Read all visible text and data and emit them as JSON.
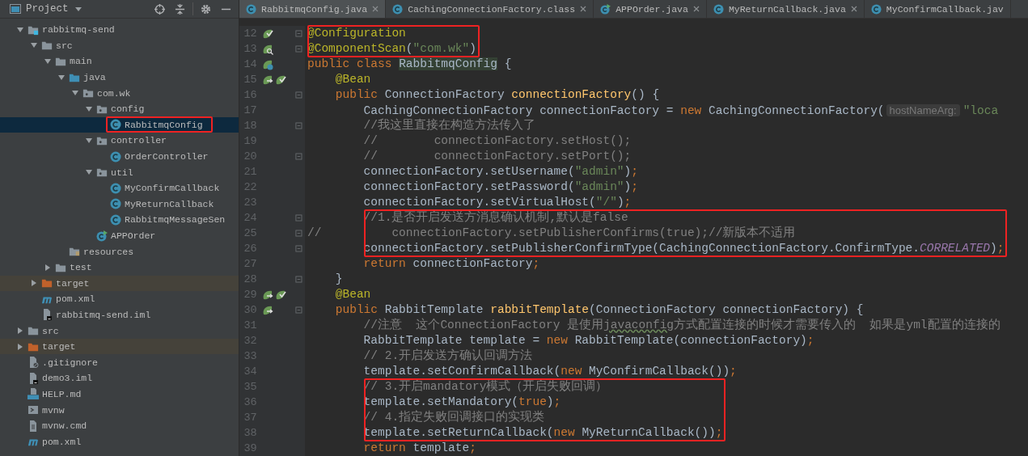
{
  "project_panel": {
    "title": "Project",
    "tree": [
      {
        "label": "rabbitmq-send",
        "kind": "module",
        "expanded": true,
        "selected": false,
        "boxed": false,
        "children": [
          {
            "label": "src",
            "kind": "folder",
            "expanded": true,
            "selected": false,
            "boxed": false,
            "children": [
              {
                "label": "main",
                "kind": "folder",
                "expanded": true,
                "selected": false,
                "boxed": false,
                "children": [
                  {
                    "label": "java",
                    "kind": "source-folder",
                    "expanded": true,
                    "selected": false,
                    "boxed": false,
                    "children": [
                      {
                        "label": "com.wk",
                        "kind": "package",
                        "expanded": true,
                        "selected": false,
                        "boxed": false,
                        "children": [
                          {
                            "label": "config",
                            "kind": "package",
                            "expanded": true,
                            "selected": false,
                            "boxed": false,
                            "children": [
                              {
                                "label": "RabbitmqConfig",
                                "kind": "class",
                                "selected": true,
                                "boxed": true
                              }
                            ]
                          },
                          {
                            "label": "controller",
                            "kind": "package",
                            "expanded": true,
                            "selected": false,
                            "boxed": false,
                            "children": [
                              {
                                "label": "OrderController",
                                "kind": "class",
                                "selected": false,
                                "boxed": false
                              }
                            ]
                          },
                          {
                            "label": "util",
                            "kind": "package",
                            "expanded": true,
                            "selected": false,
                            "boxed": false,
                            "children": [
                              {
                                "label": "MyConfirmCallback",
                                "kind": "class",
                                "selected": false,
                                "boxed": false
                              },
                              {
                                "label": "MyReturnCallback",
                                "kind": "class",
                                "selected": false,
                                "boxed": false
                              },
                              {
                                "label": "RabbitmqMessageSen",
                                "kind": "class",
                                "selected": false,
                                "boxed": false
                              }
                            ]
                          },
                          {
                            "label": "APPOrder",
                            "kind": "app-class",
                            "selected": false,
                            "boxed": false
                          }
                        ]
                      }
                    ]
                  },
                  {
                    "label": "resources",
                    "kind": "resources",
                    "selected": false,
                    "boxed": false
                  }
                ]
              },
              {
                "label": "test",
                "kind": "folder",
                "expanded": false,
                "selected": false,
                "boxed": false
              }
            ]
          },
          {
            "label": "target",
            "kind": "excluded-folder",
            "expanded": false,
            "selected": false,
            "boxed": false
          },
          {
            "label": "pom.xml",
            "kind": "maven",
            "selected": false,
            "boxed": false
          },
          {
            "label": "rabbitmq-send.iml",
            "kind": "iml",
            "selected": false,
            "boxed": false
          }
        ]
      },
      {
        "label": "src",
        "kind": "folder",
        "expanded": false,
        "selected": false,
        "boxed": false
      },
      {
        "label": "target",
        "kind": "excluded-folder",
        "expanded": false,
        "selected": false,
        "boxed": false
      },
      {
        "label": ".gitignore",
        "kind": "gitignore",
        "selected": false,
        "boxed": false
      },
      {
        "label": "demo3.iml",
        "kind": "iml",
        "selected": false,
        "boxed": false
      },
      {
        "label": "HELP.md",
        "kind": "markdown",
        "selected": false,
        "boxed": false
      },
      {
        "label": "mvnw",
        "kind": "script",
        "selected": false,
        "boxed": false
      },
      {
        "label": "mvnw.cmd",
        "kind": "text",
        "selected": false,
        "boxed": false
      },
      {
        "label": "pom.xml",
        "kind": "maven",
        "selected": false,
        "boxed": false
      }
    ]
  },
  "tabs": [
    {
      "label": "RabbitmqConfig.java",
      "kind": "class",
      "selected": true,
      "closable": true
    },
    {
      "label": "CachingConnectionFactory.class",
      "kind": "class",
      "selected": false,
      "closable": true
    },
    {
      "label": "APPOrder.java",
      "kind": "app-class",
      "selected": false,
      "closable": true
    },
    {
      "label": "MyReturnCallback.java",
      "kind": "class",
      "selected": false,
      "closable": true
    },
    {
      "label": "MyConfirmCallback.jav",
      "kind": "class",
      "selected": false,
      "closable": false
    }
  ],
  "lines": [
    {
      "number": "12",
      "gutter_icons": [
        {
          "kind": "bean-check"
        }
      ],
      "fold": true,
      "boxed": true,
      "segments": [
        {
          "kind": "annotation",
          "text": "@Configuration"
        }
      ]
    },
    {
      "number": "13",
      "gutter_icons": [
        {
          "kind": "bean-search"
        }
      ],
      "fold": true,
      "boxed": true,
      "segments": [
        {
          "kind": "annotation",
          "text": "@ComponentScan"
        },
        {
          "kind": "plain",
          "text": "("
        },
        {
          "kind": "string",
          "text": "\"com.wk\""
        },
        {
          "kind": "plain",
          "text": ")"
        }
      ]
    },
    {
      "number": "14",
      "gutter_icons": [
        {
          "kind": "bean-class"
        }
      ],
      "fold": false,
      "boxed": false,
      "segments": [
        {
          "kind": "keyword",
          "text": "public class "
        },
        {
          "kind": "highlight",
          "text": "RabbitmqConfig"
        },
        {
          "kind": "plain",
          "text": " {"
        }
      ]
    },
    {
      "number": "15",
      "gutter_icons": [
        {
          "kind": "bean-arrow"
        },
        {
          "kind": "bean-check"
        }
      ],
      "fold": false,
      "boxed": false,
      "segments": [
        {
          "kind": "annotation",
          "text": "    @Bean"
        }
      ]
    },
    {
      "number": "16",
      "fold": true,
      "boxed": false,
      "segments": [
        {
          "kind": "keyword",
          "text": "    public "
        },
        {
          "kind": "plain",
          "text": "ConnectionFactory "
        },
        {
          "kind": "method",
          "text": "connectionFactory"
        },
        {
          "kind": "plain",
          "text": "() {"
        }
      ]
    },
    {
      "number": "17",
      "fold": false,
      "boxed": false,
      "segments": [
        {
          "kind": "plain",
          "text": "        CachingConnectionFactory connectionFactory = "
        },
        {
          "kind": "keyword",
          "text": "new "
        },
        {
          "kind": "plain",
          "text": "CachingConnectionFactory("
        },
        {
          "kind": "hint",
          "text": "hostNameArg:"
        },
        {
          "kind": "string",
          "text": "\"loca"
        }
      ]
    },
    {
      "number": "18",
      "fold": true,
      "boxed": false,
      "segments": [
        {
          "kind": "comment",
          "text": "        //我这里直接在构造方法传入了"
        }
      ]
    },
    {
      "number": "19",
      "fold": false,
      "boxed": false,
      "segments": [
        {
          "kind": "comment",
          "text": "        //        connectionFactory.setHost();"
        }
      ]
    },
    {
      "number": "20",
      "fold": true,
      "boxed": false,
      "segments": [
        {
          "kind": "comment",
          "text": "        //        connectionFactory.setPort();"
        }
      ]
    },
    {
      "number": "21",
      "fold": false,
      "boxed": false,
      "segments": [
        {
          "kind": "plain",
          "text": "        connectionFactory.setUsername("
        },
        {
          "kind": "string",
          "text": "\"admin\""
        },
        {
          "kind": "plain",
          "text": ")"
        },
        {
          "kind": "keyword",
          "text": ";"
        }
      ]
    },
    {
      "number": "22",
      "fold": false,
      "boxed": false,
      "segments": [
        {
          "kind": "plain",
          "text": "        connectionFactory.setPassword("
        },
        {
          "kind": "string",
          "text": "\"admin\""
        },
        {
          "kind": "plain",
          "text": ")"
        },
        {
          "kind": "keyword",
          "text": ";"
        }
      ]
    },
    {
      "number": "23",
      "fold": false,
      "boxed": false,
      "segments": [
        {
          "kind": "plain",
          "text": "        connectionFactory.setVirtualHost("
        },
        {
          "kind": "string",
          "text": "\"/\""
        },
        {
          "kind": "plain",
          "text": ")"
        },
        {
          "kind": "keyword",
          "text": ";"
        }
      ]
    },
    {
      "number": "24",
      "fold": true,
      "boxed": true,
      "segments": [
        {
          "kind": "comment",
          "text": "        //1.是否开启发送方消息确认机制,默认是false"
        }
      ]
    },
    {
      "number": "25",
      "fold": true,
      "boxed": true,
      "segments": [
        {
          "kind": "comment",
          "text": "//          connectionFactory.setPublisherConfirms(true);//新版本不适用"
        }
      ]
    },
    {
      "number": "26",
      "fold": true,
      "boxed": true,
      "segments": [
        {
          "kind": "plain",
          "text": "        connectionFactory.setPublisherConfirmType(CachingConnectionFactory.ConfirmType."
        },
        {
          "kind": "constant",
          "text": "CORRELATED"
        },
        {
          "kind": "plain",
          "text": ")"
        },
        {
          "kind": "keyword",
          "text": ";"
        }
      ]
    },
    {
      "number": "27",
      "fold": false,
      "boxed": false,
      "segments": [
        {
          "kind": "keyword",
          "text": "        return "
        },
        {
          "kind": "plain",
          "text": "connectionFactory"
        },
        {
          "kind": "keyword",
          "text": ";"
        }
      ]
    },
    {
      "number": "28",
      "fold": true,
      "boxed": false,
      "segments": [
        {
          "kind": "plain",
          "text": "    }"
        }
      ]
    },
    {
      "number": "29",
      "gutter_icons": [
        {
          "kind": "bean-arrow"
        },
        {
          "kind": "bean-check"
        }
      ],
      "fold": false,
      "boxed": false,
      "segments": [
        {
          "kind": "annotation",
          "text": "    @Bean"
        }
      ]
    },
    {
      "number": "30",
      "gutter_icons": [
        {
          "kind": "bean-arrow"
        }
      ],
      "fold": true,
      "boxed": false,
      "segments": [
        {
          "kind": "keyword",
          "text": "    public "
        },
        {
          "kind": "plain",
          "text": "RabbitTemplate "
        },
        {
          "kind": "method",
          "text": "rabbitTemplate"
        },
        {
          "kind": "plain",
          "text": "(ConnectionFactory connectionFactory) {"
        }
      ]
    },
    {
      "number": "31",
      "fold": false,
      "boxed": false,
      "segments": [
        {
          "kind": "comment",
          "text": "        //注意  这个ConnectionFactory 是使用"
        },
        {
          "kind": "comment-typo",
          "text": "javaconfig"
        },
        {
          "kind": "comment",
          "text": "方式配置连接的时候才需要传入的  如果是yml配置的连接的"
        }
      ]
    },
    {
      "number": "32",
      "fold": false,
      "boxed": false,
      "segments": [
        {
          "kind": "plain",
          "text": "        RabbitTemplate template = "
        },
        {
          "kind": "keyword",
          "text": "new "
        },
        {
          "kind": "plain",
          "text": "RabbitTemplate(connectionFactory)"
        },
        {
          "kind": "keyword",
          "text": ";"
        }
      ]
    },
    {
      "number": "33",
      "fold": false,
      "boxed": false,
      "segments": [
        {
          "kind": "comment",
          "text": "        // 2.开启发送方确认回调方法"
        }
      ]
    },
    {
      "number": "34",
      "fold": false,
      "boxed": false,
      "segments": [
        {
          "kind": "plain",
          "text": "        template.setConfirmCallback("
        },
        {
          "kind": "keyword",
          "text": "new "
        },
        {
          "kind": "plain",
          "text": "MyConfirmCallback())"
        },
        {
          "kind": "keyword",
          "text": ";"
        }
      ]
    },
    {
      "number": "35",
      "fold": false,
      "boxed": true,
      "segments": [
        {
          "kind": "comment",
          "text": "        // 3.开启mandatory模式（开启失败回调）"
        }
      ]
    },
    {
      "number": "36",
      "fold": false,
      "boxed": true,
      "segments": [
        {
          "kind": "plain",
          "text": "        template.setMandatory("
        },
        {
          "kind": "keyword",
          "text": "true"
        },
        {
          "kind": "plain",
          "text": ")"
        },
        {
          "kind": "keyword",
          "text": ";"
        }
      ]
    },
    {
      "number": "37",
      "fold": false,
      "boxed": true,
      "segments": [
        {
          "kind": "comment",
          "text": "        // 4.指定失败回调接口的实现类"
        }
      ]
    },
    {
      "number": "38",
      "fold": false,
      "boxed": true,
      "segments": [
        {
          "kind": "plain",
          "text": "        template.setReturnCallback("
        },
        {
          "kind": "keyword",
          "text": "new "
        },
        {
          "kind": "plain",
          "text": "MyReturnCallback())"
        },
        {
          "kind": "keyword",
          "text": ";"
        }
      ]
    },
    {
      "number": "39",
      "fold": false,
      "boxed": false,
      "segments": [
        {
          "kind": "keyword",
          "text": "        return "
        },
        {
          "kind": "plain",
          "text": "template"
        },
        {
          "kind": "keyword",
          "text": ";"
        }
      ]
    }
  ]
}
